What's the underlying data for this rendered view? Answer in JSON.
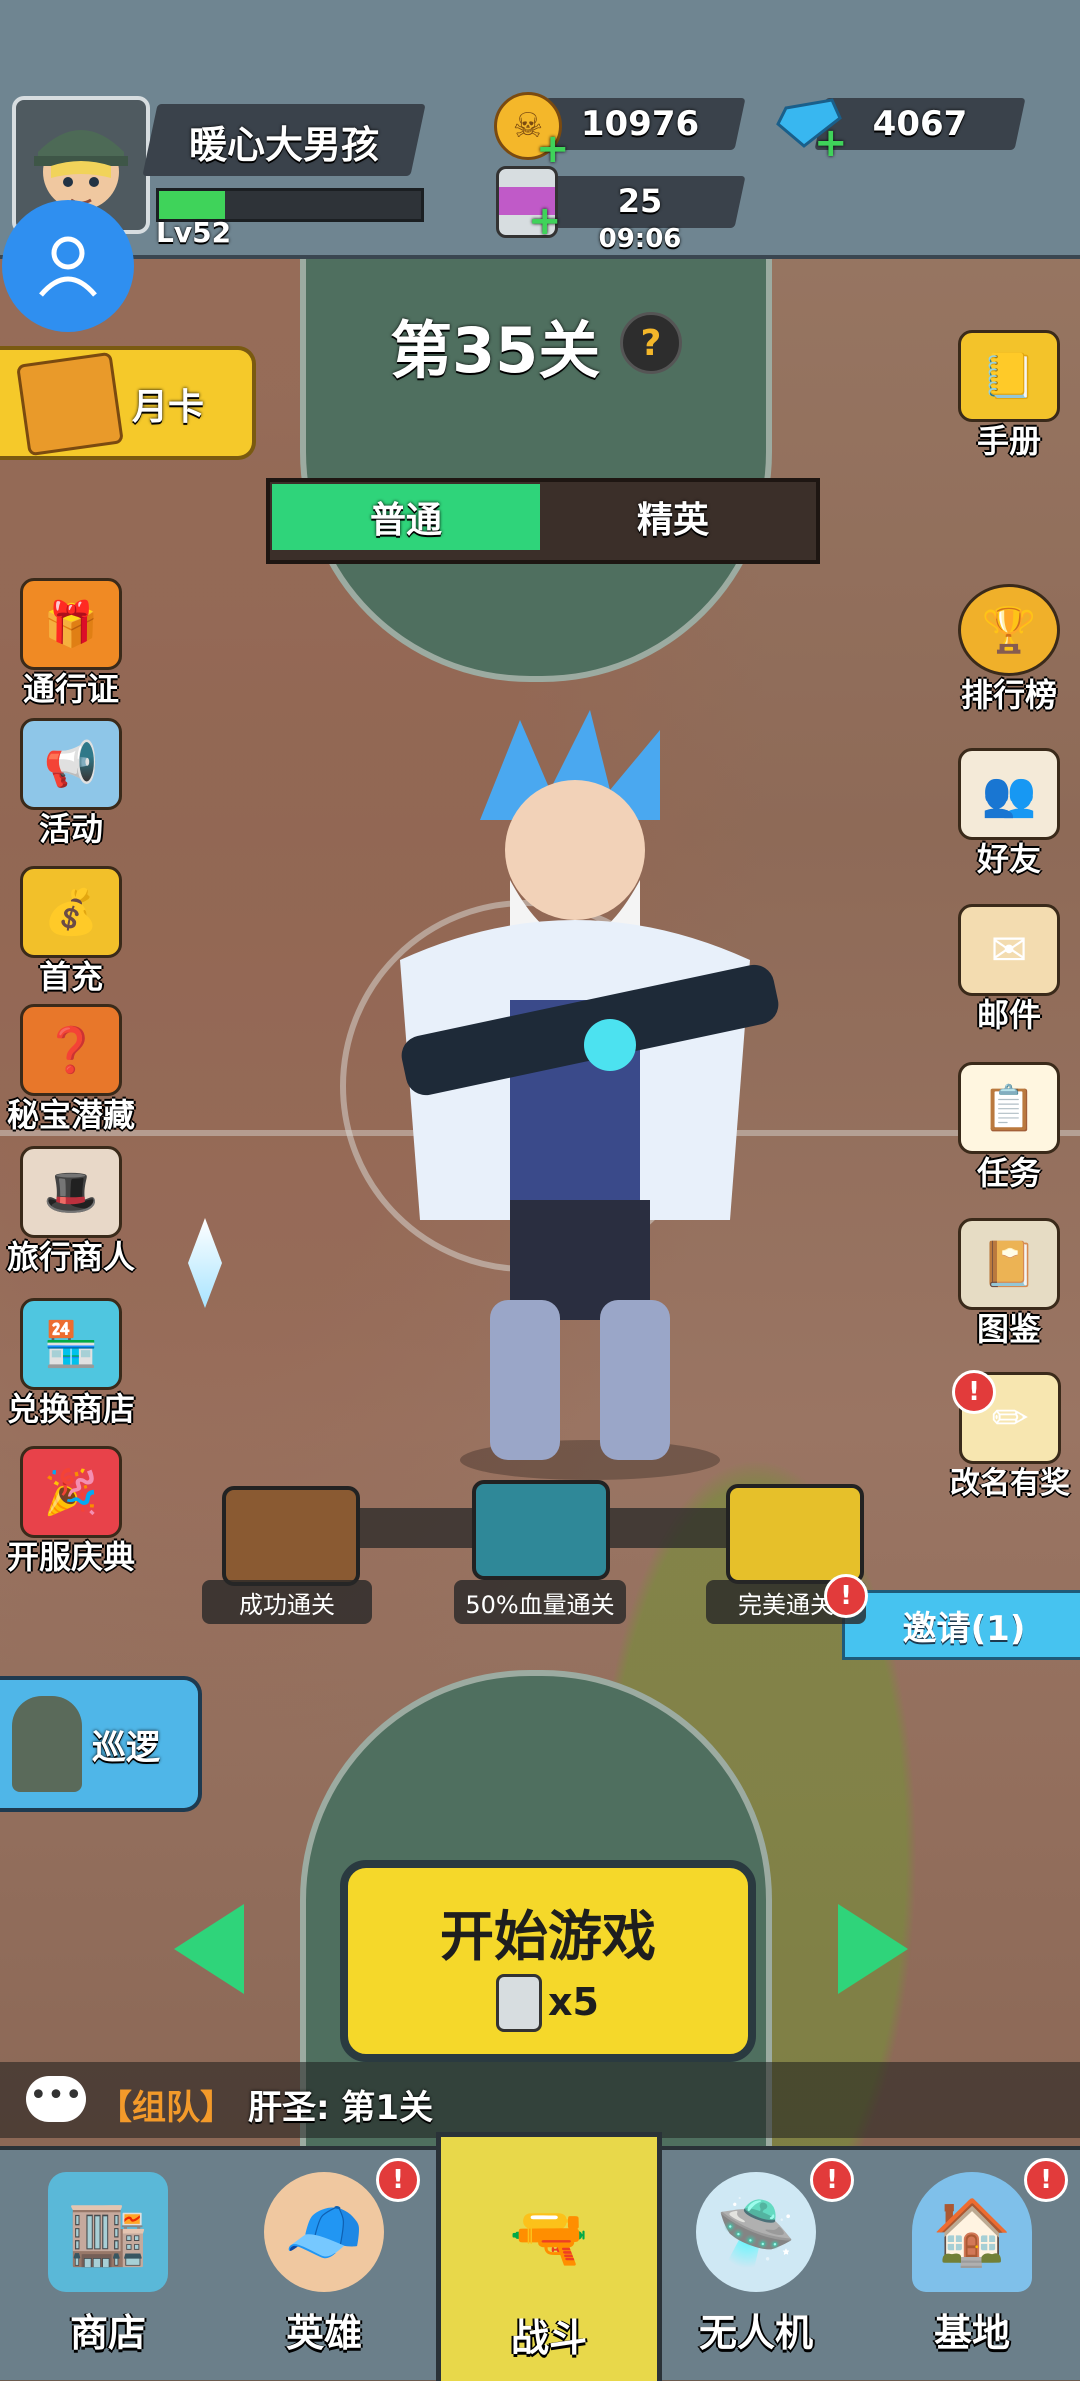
{
  "player": {
    "name": "暖心大男孩",
    "level": "Lv52",
    "xp_fraction": 0.25
  },
  "currency": {
    "coins": "10976",
    "gems": "4067",
    "energy": "25",
    "energy_timer": "09:06"
  },
  "stage": {
    "title": "第35关",
    "help": "?"
  },
  "difficulty": {
    "normal": "普通",
    "elite": "精英"
  },
  "left_menu": {
    "monthly_card": "月卡",
    "items": [
      "通行证",
      "活动",
      "首充",
      "秘宝潜藏",
      "旅行商人",
      "兑换商店",
      "开服庆典"
    ],
    "patrol": "巡逻"
  },
  "right_menu": {
    "items": [
      "手册",
      "排行榜",
      "好友",
      "邮件",
      "任务",
      "图鉴",
      "改名有奖"
    ],
    "invite": "邀请(1)"
  },
  "rewards": [
    "成功通关",
    "50%血量通关",
    "完美通关"
  ],
  "start": {
    "label": "开始游戏",
    "cost": "x5"
  },
  "chat": {
    "channel": "【组队】",
    "message": "肝圣: 第1关"
  },
  "nav": [
    "商店",
    "英雄",
    "战斗",
    "无人机",
    "基地"
  ],
  "badge": "!",
  "colors": {
    "accent_green": "#2fd47a",
    "start_yellow": "#f5d82a",
    "alert_red": "#e23b3b",
    "invite_blue": "#46c3f0"
  }
}
